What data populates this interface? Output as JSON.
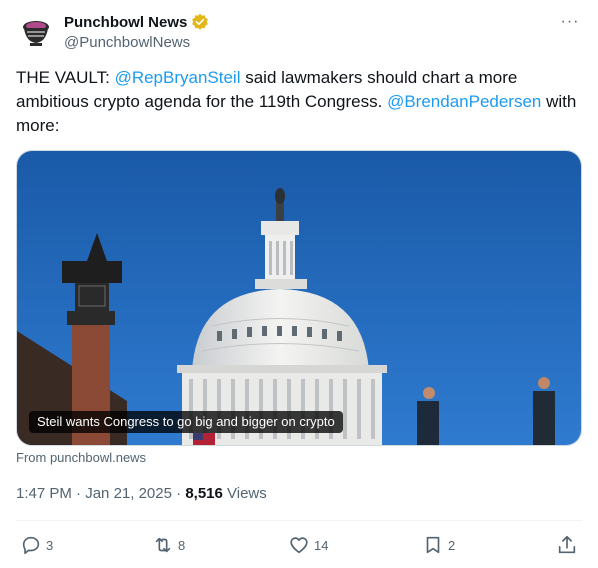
{
  "author": {
    "display_name": "Punchbowl News",
    "handle": "@PunchbowlNews",
    "verified_color": "#e2b719"
  },
  "menu": {
    "more_label": "···"
  },
  "tweet": {
    "text_1": "THE VAULT: ",
    "mention_1": "@RepBryanSteil",
    "text_2": " said lawmakers should chart a more ambitious crypto agenda for the 119th Congress. ",
    "mention_2": "@BrendanPedersen",
    "text_3": " with more:"
  },
  "card": {
    "caption": "Steil wants Congress to go big and bigger on crypto",
    "source": "From punchbowl.news"
  },
  "meta": {
    "time": "1:47 PM",
    "sep": " · ",
    "date": "Jan 21, 2025",
    "sep2": " · ",
    "views_count": "8,516",
    "views_label": " Views"
  },
  "actions": {
    "replies": "3",
    "reposts": "8",
    "likes": "14",
    "bookmarks": "2"
  },
  "colors": {
    "accent": "#1d9bf0",
    "muted": "#536471",
    "sky": "#1d63b5"
  }
}
